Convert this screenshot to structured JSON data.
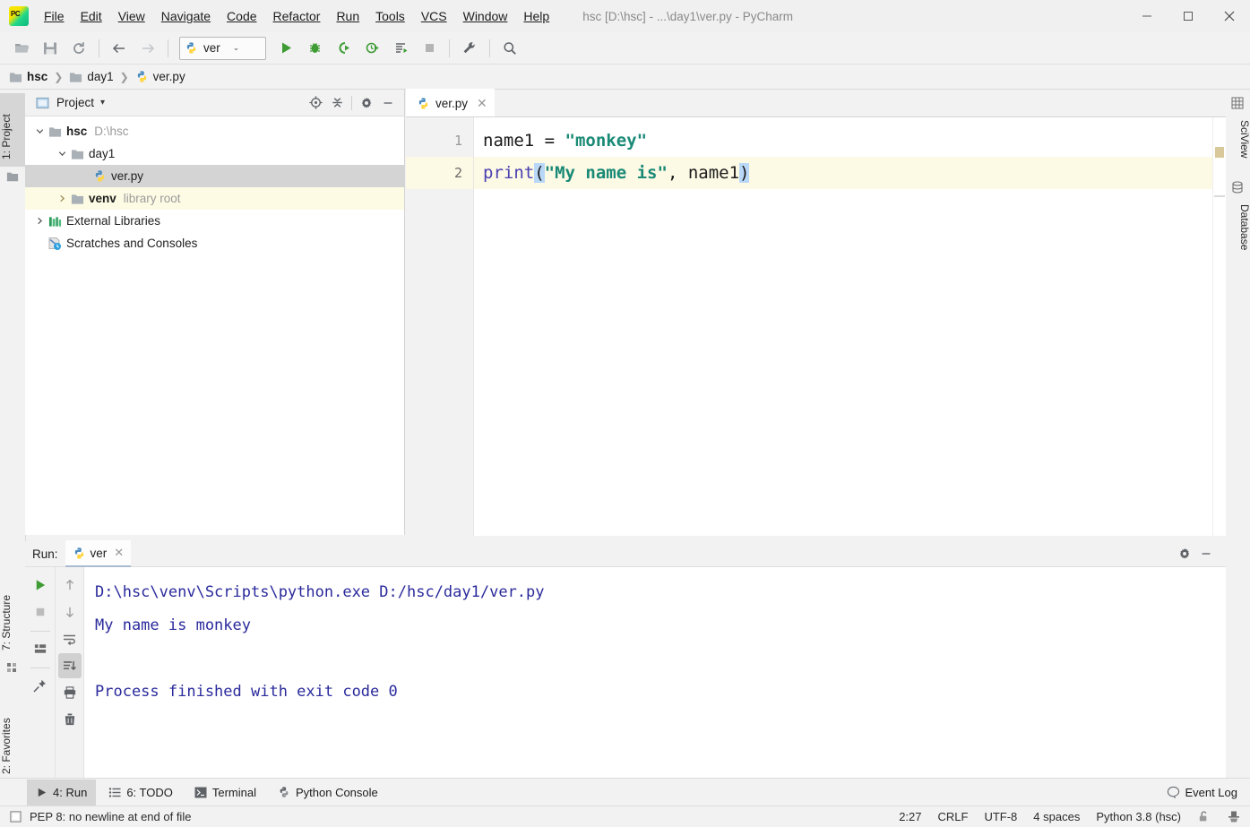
{
  "window": {
    "title": "hsc [D:\\hsc] - ...\\day1\\ver.py - PyCharm",
    "minimize_label": "—",
    "maximize_label": "☐",
    "close_label": "✕"
  },
  "menubar": [
    {
      "label": "File"
    },
    {
      "label": "Edit"
    },
    {
      "label": "View"
    },
    {
      "label": "Navigate"
    },
    {
      "label": "Code"
    },
    {
      "label": "Refactor"
    },
    {
      "label": "Run"
    },
    {
      "label": "Tools"
    },
    {
      "label": "VCS"
    },
    {
      "label": "Window"
    },
    {
      "label": "Help"
    }
  ],
  "toolbar": {
    "icons": [
      {
        "name": "open-folder-icon"
      },
      {
        "name": "save-all-icon"
      },
      {
        "name": "sync-refresh-icon"
      },
      {
        "name": "navigate-back-icon"
      },
      {
        "name": "navigate-forward-icon"
      }
    ],
    "run_config": {
      "label": "ver",
      "caret": "⌄"
    },
    "run_icons": [
      {
        "name": "run-icon"
      },
      {
        "name": "debug-icon"
      },
      {
        "name": "run-with-coverage-icon"
      },
      {
        "name": "profile-icon"
      },
      {
        "name": "run-tests-icon"
      },
      {
        "name": "stop-icon"
      }
    ],
    "right_icons": [
      {
        "name": "settings-wrench-icon"
      },
      {
        "name": "search-everywhere-icon"
      }
    ]
  },
  "breadcrumb": {
    "separator": "❯",
    "items": [
      {
        "label": "hsc",
        "icon": "folder-icon",
        "bold": true
      },
      {
        "label": "day1",
        "icon": "folder-icon",
        "bold": false
      },
      {
        "label": "ver.py",
        "icon": "python-file-icon",
        "bold": false
      }
    ]
  },
  "left_stripe": {
    "top_tab": {
      "label": "1: Project",
      "icon": "project-folder-icon",
      "active": true
    },
    "bottom_tabs": [
      {
        "label": "7: Structure",
        "icon": "structure-icon"
      },
      {
        "label": "2: Favorites",
        "icon": "star-icon"
      }
    ]
  },
  "right_stripe": {
    "tabs": [
      {
        "label": "SciView",
        "icon": "grid-icon"
      },
      {
        "label": "Database",
        "icon": "database-icon"
      }
    ]
  },
  "project_panel": {
    "title": "Project",
    "title_caret": "▾",
    "actions": [
      {
        "name": "locate-target-icon"
      },
      {
        "name": "collapse-all-icon"
      },
      {
        "name": "settings-gear-icon"
      },
      {
        "name": "hide-panel-icon"
      }
    ],
    "tree": [
      {
        "label": "hsc",
        "sub": "D:\\hsc",
        "arrow": "expanded",
        "icon": "folder-icon",
        "indent": 0,
        "bold": true,
        "state": "normal"
      },
      {
        "label": "day1",
        "sub": "",
        "arrow": "expanded",
        "icon": "folder-icon",
        "indent": 1,
        "bold": false,
        "state": "normal"
      },
      {
        "label": "ver.py",
        "sub": "",
        "arrow": "none",
        "icon": "python-file-icon",
        "indent": 2,
        "bold": false,
        "state": "selected"
      },
      {
        "label": "venv",
        "sub": "library root",
        "arrow": "collapsed",
        "icon": "folder-icon",
        "indent": 1,
        "bold": true,
        "state": "vcs"
      },
      {
        "label": "External Libraries",
        "sub": "",
        "arrow": "collapsed",
        "icon": "libraries-icon",
        "indent": 0,
        "bold": false,
        "state": "normal"
      },
      {
        "label": "Scratches and Consoles",
        "sub": "",
        "arrow": "none",
        "icon": "scratches-icon",
        "indent": 0,
        "bold": false,
        "state": "normal"
      }
    ]
  },
  "editor": {
    "tab": {
      "label": "ver.py",
      "icon": "python-file-icon",
      "close": "✕"
    },
    "lines": [
      {
        "number": "1",
        "current": false
      },
      {
        "number": "2",
        "current": true
      }
    ],
    "code": {
      "line1": {
        "var": "name1",
        "eq": " = ",
        "string": "\"monkey\""
      },
      "line2": {
        "fn": "print",
        "open": "(",
        "string": "\"My name is\"",
        "comma": ", ",
        "arg": "name1",
        "close": ")"
      }
    }
  },
  "run_panel": {
    "label": "Run:",
    "tab": {
      "label": "ver",
      "icon": "python-icon",
      "close": "✕"
    },
    "actions": [
      {
        "name": "rerun-icon"
      },
      {
        "name": "stop-process-icon"
      },
      {
        "name": "show-layout-icon"
      },
      {
        "name": "pin-tab-icon"
      },
      {
        "name": "scroll-up-icon"
      },
      {
        "name": "scroll-down-icon"
      },
      {
        "name": "soft-wrap-icon"
      },
      {
        "name": "scroll-to-end-icon"
      },
      {
        "name": "print-icon"
      },
      {
        "name": "clear-all-icon"
      },
      {
        "name": "settings-gear-icon"
      },
      {
        "name": "hide-panel-icon"
      }
    ],
    "console_lines": [
      "D:\\hsc\\venv\\Scripts\\python.exe D:/hsc/day1/ver.py",
      "My name is monkey",
      "",
      "Process finished with exit code 0"
    ]
  },
  "bottom_tabs": [
    {
      "label": "4: Run",
      "icon": "run-icon",
      "active": true
    },
    {
      "label": "6: TODO",
      "icon": "todo-icon",
      "active": false
    },
    {
      "label": "Terminal",
      "icon": "terminal-icon",
      "active": false
    },
    {
      "label": "Python Console",
      "icon": "python-icon",
      "active": false
    }
  ],
  "event_log": {
    "label": "Event Log",
    "icon": "balloon-icon"
  },
  "statusbar": {
    "message": "PEP 8: no newline at end of file",
    "message_icon": "inspection-icon",
    "caret_position": "2:27",
    "line_separator": "CRLF",
    "encoding": "UTF-8",
    "indent": "4 spaces",
    "interpreter": "Python 3.8 (hsc)",
    "lock_icon": "unlocked-icon",
    "hector_icon": "hector-hat-icon"
  },
  "colors": {
    "accent_green": "#3f9c35",
    "string_teal": "#1a8a76",
    "keyword_purple": "#4a3fb0",
    "console_blue": "#2a2a9c",
    "selection_gray": "#d4d4d4",
    "vcs_yellow": "#fdfbe4",
    "current_line": "#fcf9e5",
    "paren_match": "#b9d7f7"
  }
}
